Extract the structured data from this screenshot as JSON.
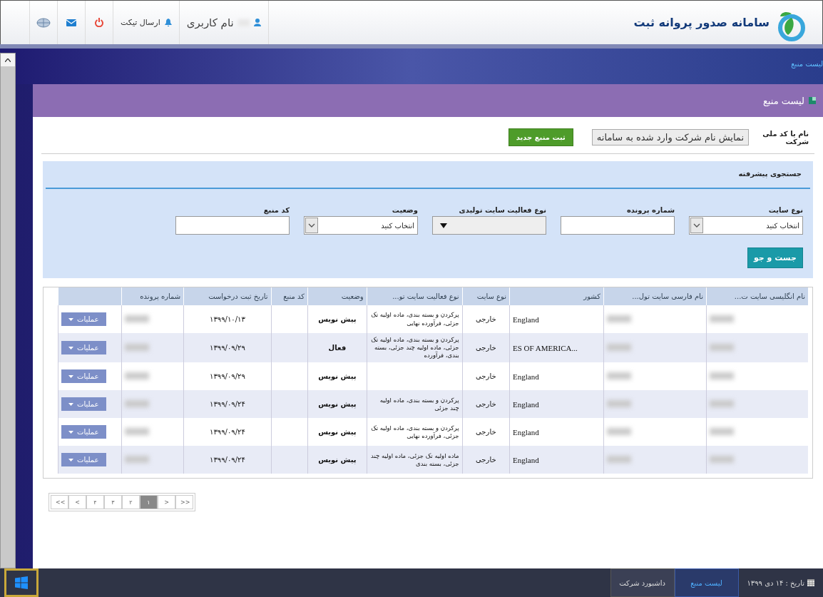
{
  "header": {
    "app_title": "سامانه صدور پروانه ثبت",
    "user": "نام کاربری",
    "ticket": "ارسال تیکت"
  },
  "breadcrumb": "لیست منبع",
  "panel": {
    "title": "لیست منبع"
  },
  "company": {
    "label": "نام یا کد ملی شرکت",
    "value": "نمایش نام شرکت وارد شده به سامانه",
    "new_button": "ثبت منبع جدید"
  },
  "search": {
    "title": "جستجوی پیشرفته",
    "button": "جست و جو",
    "fields": [
      {
        "kind": "select",
        "label": "نوع سایت",
        "value": "انتخاب کنید"
      },
      {
        "kind": "text",
        "label": "شماره پرونده"
      },
      {
        "kind": "multiselect",
        "label": "نوع فعالیت سایت تولیدی"
      },
      {
        "kind": "select",
        "label": "وضعیت",
        "value": "انتخاب کنید"
      },
      {
        "kind": "text",
        "label": "کد منبع"
      }
    ]
  },
  "table": {
    "columns": [
      "نام انگلیسی سایت ت...",
      "نام فارسی سایت تول...",
      "کشور",
      "نوع سایت",
      "نوع فعالیت سایت تو...",
      "وضعیت",
      "کد منبع",
      "تاریخ ثبت درخواست",
      "شماره پرونده"
    ],
    "rows": [
      {
        "country": "England",
        "site_type": "خارجی",
        "activity": "پرکردن و بسته بندی، ماده اولیه تک جزئی، فرآورده نهایی",
        "status": "پیش نویس",
        "code": "",
        "date": "۱۳۹۹/۱۰/۱۳",
        "action": "عملیات"
      },
      {
        "country": "...ES OF AMERICA",
        "site_type": "خارجی",
        "activity": "پرکردن و بسته بندی، ماده اولیه تک جزئی، ماده اولیه چند جزئی، بسته بندی، فرآورده",
        "status": "فعال",
        "code": "",
        "date": "۱۳۹۹/۰۹/۲۹",
        "action": "عملیات"
      },
      {
        "country": "England",
        "site_type": "خارجی",
        "activity": "",
        "status": "پیش نویس",
        "code": "",
        "date": "۱۳۹۹/۰۹/۲۹",
        "action": "عملیات"
      },
      {
        "country": "England",
        "site_type": "خارجی",
        "activity": "پرکردن و بسته بندی، ماده اولیه چند جزئی",
        "status": "پیش نویس",
        "code": "",
        "date": "۱۳۹۹/۰۹/۲۴",
        "action": "عملیات"
      },
      {
        "country": "England",
        "site_type": "خارجی",
        "activity": "پرکردن و بسته بندی، ماده اولیه تک جزئی، فرآورده نهایی",
        "status": "پیش نویس",
        "code": "",
        "date": "۱۳۹۹/۰۹/۲۴",
        "action": "عملیات"
      },
      {
        "country": "England",
        "site_type": "خارجی",
        "activity": "ماده اولیه تک جزئی، ماده اولیه چند جزئی، بسته بندی",
        "status": "پیش نویس",
        "code": "",
        "date": "۱۳۹۹/۰۹/۲۴",
        "action": "عملیات"
      }
    ]
  },
  "pagination": [
    {
      "label": ">>",
      "selected": false
    },
    {
      "label": ">",
      "selected": false
    },
    {
      "label": "۱",
      "selected": true
    },
    {
      "label": "۲",
      "selected": false
    },
    {
      "label": "۳",
      "selected": false
    },
    {
      "label": "۴",
      "selected": false
    },
    {
      "label": "<",
      "selected": false
    },
    {
      "label": "<<",
      "selected": false
    }
  ],
  "taskbar": {
    "date": "تاریخ : ۱۴ دی ۱۳۹۹",
    "tabs": [
      {
        "label": "لیست منبع",
        "selected": true
      },
      {
        "label": "داشبورد شرکت",
        "selected": false
      }
    ]
  }
}
